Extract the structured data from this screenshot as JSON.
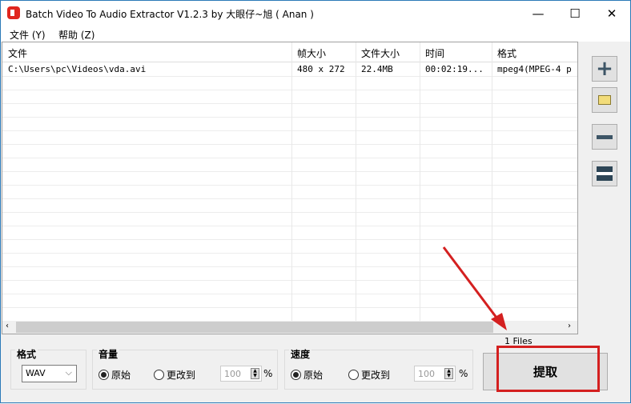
{
  "window": {
    "title": "Batch Video To Audio Extractor V1.2.3 by 大眼仔~旭 ( Anan )",
    "minimize": "—",
    "maximize": "☐",
    "close": "✕"
  },
  "menu": [
    {
      "label": "文件 (Y)"
    },
    {
      "label": "帮助 (Z)"
    }
  ],
  "table": {
    "columns": [
      "文件",
      "帧大小",
      "文件大小",
      "时间",
      "格式"
    ],
    "rows": [
      [
        "C:\\Users\\pc\\Videos\\vda.avi",
        "480 x 272",
        "22.4MB",
        "00:02:19...",
        "mpeg4(MPEG-4 p"
      ]
    ]
  },
  "side_buttons": [
    {
      "icon": "add-icon"
    },
    {
      "icon": "add-folder-icon"
    },
    {
      "icon": "remove-icon"
    },
    {
      "icon": "clear-all-icon"
    }
  ],
  "format": {
    "label": "格式",
    "value": "WAV"
  },
  "volume": {
    "label": "音量",
    "original": "原始",
    "change": "更改到",
    "value": "100",
    "unit": "%",
    "selected": "original"
  },
  "speed": {
    "label": "速度",
    "original": "原始",
    "change": "更改到",
    "value": "100",
    "unit": "%",
    "selected": "original"
  },
  "status": {
    "files": "1 Files"
  },
  "extract_button": "提取",
  "accent": "#e0261e"
}
